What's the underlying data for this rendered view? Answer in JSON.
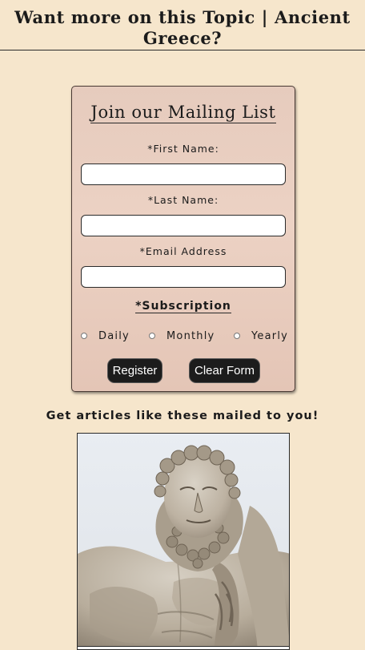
{
  "header": {
    "title": "Want more on this Topic | Ancient Greece?"
  },
  "form": {
    "title": "Join our Mailing List",
    "first_name_label": "*First Name:",
    "last_name_label": "*Last Name:",
    "email_label": "*Email Address",
    "first_name_value": "",
    "last_name_value": "",
    "email_value": "",
    "subscription_title": "*Subscription",
    "options": [
      "Daily",
      "Monthly",
      "Yearly"
    ],
    "register_label": "Register",
    "clear_label": "Clear Form"
  },
  "promo": {
    "text": "Get articles like these mailed to you!"
  },
  "image": {
    "icon": "hercules-statue-image"
  }
}
